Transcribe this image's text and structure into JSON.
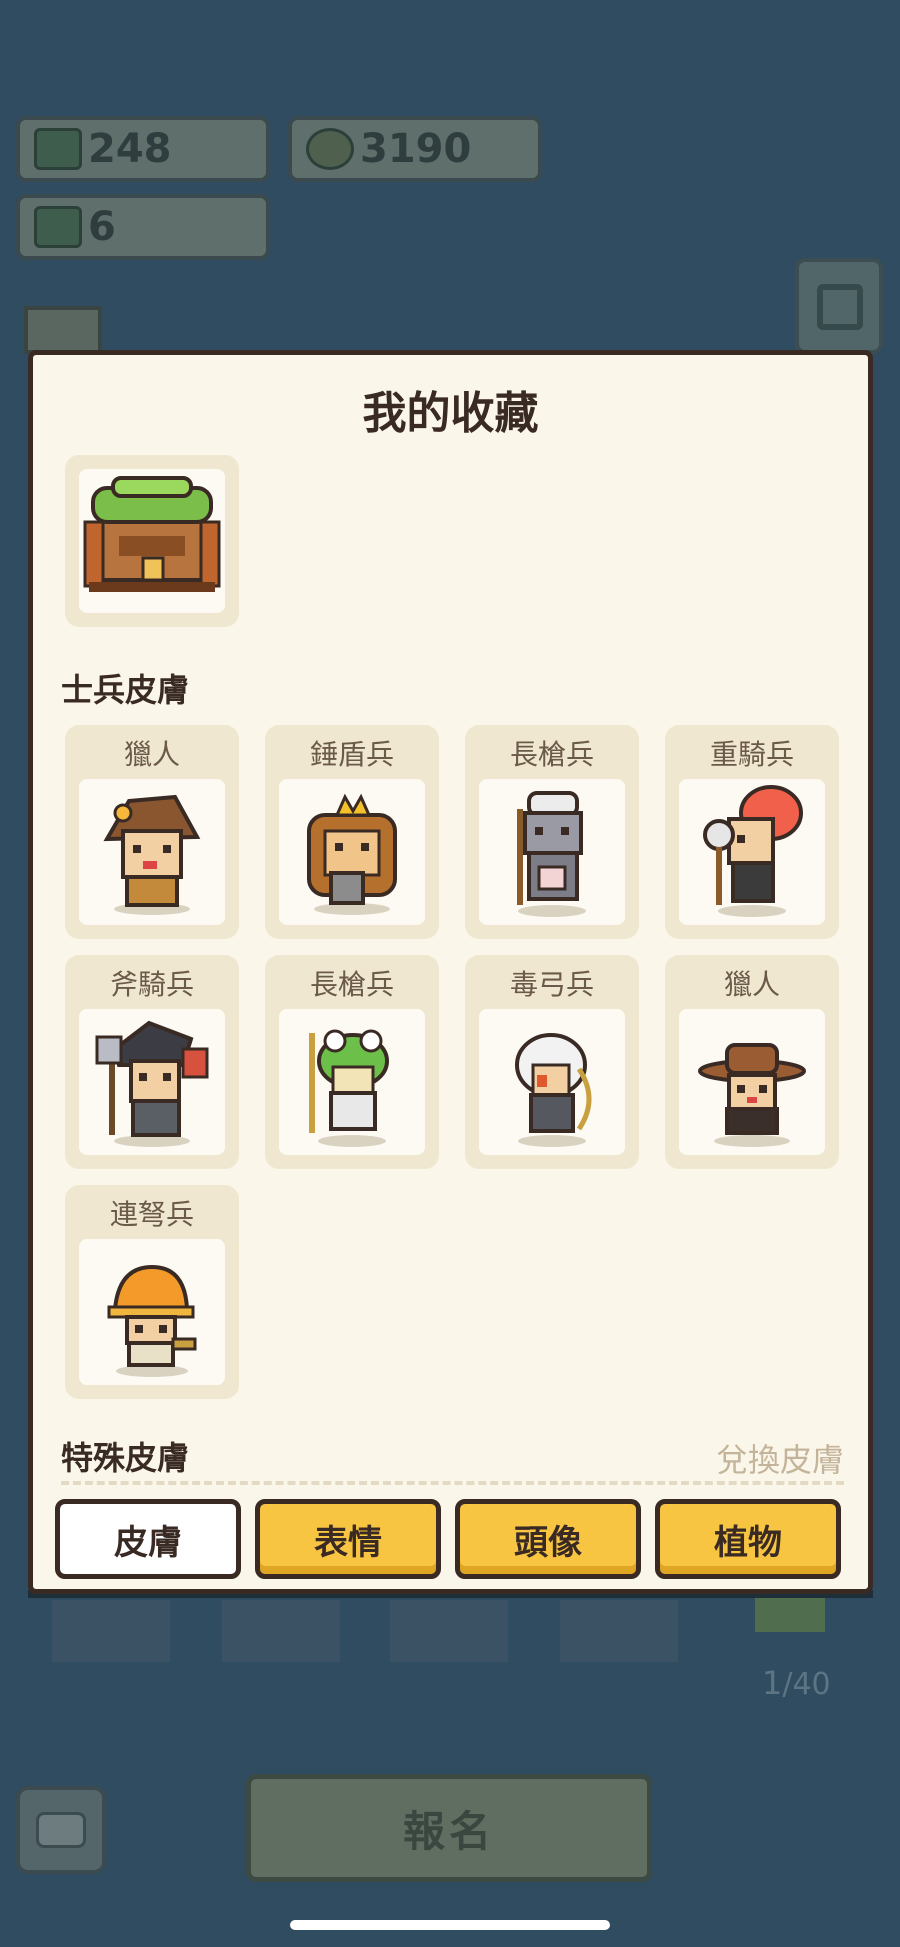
{
  "resources": [
    {
      "icon": "helmet-icon",
      "value": "248"
    },
    {
      "icon": "coin-icon",
      "value": "3190"
    },
    {
      "icon": "scroll-icon",
      "value": "6"
    }
  ],
  "modal": {
    "title": "我的收藏",
    "soldier_section_label": "士兵皮膚",
    "soldier_skins": [
      {
        "name": "獵人",
        "sprite": "hunter-brown-hat-sprite"
      },
      {
        "name": "錘盾兵",
        "sprite": "hammer-shield-lion-sprite"
      },
      {
        "name": "長槍兵",
        "sprite": "spearman-chef-sprite"
      },
      {
        "name": "重騎兵",
        "sprite": "heavy-cavalry-red-hair-sprite"
      },
      {
        "name": "斧騎兵",
        "sprite": "axe-cavalry-sprite"
      },
      {
        "name": "長槍兵",
        "sprite": "spearman-frog-sprite"
      },
      {
        "name": "毒弓兵",
        "sprite": "poison-archer-white-hair-sprite"
      },
      {
        "name": "獵人",
        "sprite": "hunter-cowboy-sprite"
      },
      {
        "name": "連弩兵",
        "sprite": "crossbowman-hardhat-sprite"
      }
    ],
    "special_section_label": "特殊皮膚",
    "exchange_label": "兌換皮膚",
    "tabs": [
      {
        "label": "皮膚",
        "active": true
      },
      {
        "label": "表情",
        "active": false
      },
      {
        "label": "頭像",
        "active": false
      },
      {
        "label": "植物",
        "active": false
      }
    ]
  },
  "counter": {
    "current": "1",
    "sep": "/",
    "total": "40"
  },
  "signup_label": "報名",
  "colors": {
    "background": "#2f4c60",
    "modal_bg": "#faf6ea",
    "card_bg": "#efe7cf",
    "tab_yellow": "#f7c542",
    "text_dark": "#3a2a24"
  }
}
